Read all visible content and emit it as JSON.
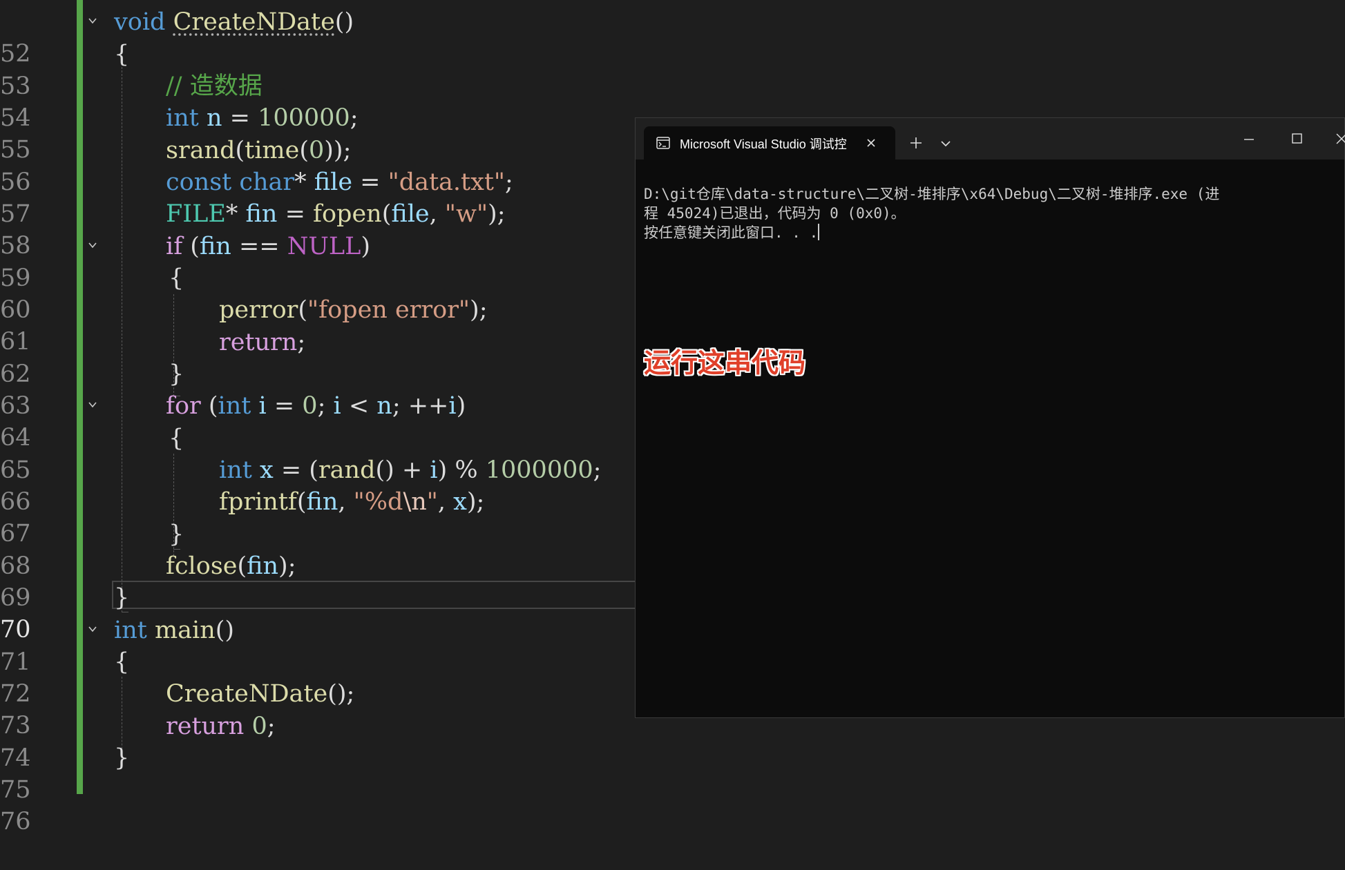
{
  "editor": {
    "lines": [
      {
        "n": "52"
      },
      {
        "n": "53"
      },
      {
        "n": "54"
      },
      {
        "n": "55"
      },
      {
        "n": "56"
      },
      {
        "n": "57"
      },
      {
        "n": "58"
      },
      {
        "n": "59"
      },
      {
        "n": "60"
      },
      {
        "n": "61"
      },
      {
        "n": "62"
      },
      {
        "n": "63"
      },
      {
        "n": "64"
      },
      {
        "n": "65"
      },
      {
        "n": "66"
      },
      {
        "n": "67"
      },
      {
        "n": "68"
      },
      {
        "n": "69"
      },
      {
        "n": "70"
      },
      {
        "n": "71"
      },
      {
        "n": "72"
      },
      {
        "n": "73"
      },
      {
        "n": "74"
      },
      {
        "n": "75"
      },
      {
        "n": "76"
      }
    ],
    "current_line": "70",
    "code": {
      "l52": {
        "kw": "void",
        "fn": "CreateNDate",
        "rest": "()"
      },
      "l53": "{",
      "l54": "// 造数据",
      "l55": {
        "kw": "int",
        "var": "n",
        "op": " = ",
        "num": "100000",
        "end": ";"
      },
      "l56": {
        "fn1": "srand",
        "p1": "(",
        "fn2": "time",
        "p2": "(",
        "num": "0",
        "end": "));"
      },
      "l57": {
        "kw1": "const",
        "kw2": "char",
        "star": "* ",
        "var": "file",
        "op": " = ",
        "str": "\"data.txt\"",
        "end": ";"
      },
      "l58": {
        "type": "FILE",
        "star": "* ",
        "var1": "fin",
        "op": " = ",
        "fn": "fopen",
        "p": "(",
        "var2": "file",
        "comma": ", ",
        "str": "\"w\"",
        "end": ");"
      },
      "l59": {
        "kw": "if",
        "p": " (",
        "var": "fin",
        "op": " == ",
        "mac": "NULL",
        "end": ")"
      },
      "l60": "{",
      "l61": {
        "fn": "perror",
        "p": "(",
        "str": "\"fopen error\"",
        "end": ");"
      },
      "l62": {
        "kw": "return",
        "end": ";"
      },
      "l63": "}",
      "l64": {
        "kw": "for",
        "p": " (",
        "kw2": "int",
        "var1": "i",
        "op1": " = ",
        "num": "0",
        "semi1": "; ",
        "var2": "i",
        "op2": " < ",
        "var3": "n",
        "semi2": "; ",
        "op3": "++",
        "var4": "i",
        "end": ")"
      },
      "l65": "{",
      "l66": {
        "kw": "int",
        "var1": "x",
        "op1": " = (",
        "fn": "rand",
        "p": "() + ",
        "var2": "i",
        "op2": ") % ",
        "num": "1000000",
        "end": ";"
      },
      "l67": {
        "fn": "fprintf",
        "p": "(",
        "var1": "fin",
        "comma": ", ",
        "str1": "\"%d",
        "esc": "\\n",
        "str2": "\"",
        "comma2": ", ",
        "var2": "x",
        "end": ");"
      },
      "l68": "}",
      "l69": {
        "fn": "fclose",
        "p": "(",
        "var": "fin",
        "end": ");"
      },
      "l70": "}",
      "l71": {
        "kw": "int",
        "fn": "main",
        "rest": "()"
      },
      "l72": "{",
      "l73": {
        "fn": "CreateNDate",
        "end": "();"
      },
      "l74": {
        "kw": "return",
        "num": "0",
        "end": ";"
      },
      "l75": "}"
    }
  },
  "terminal": {
    "tab_title": "Microsoft Visual Studio 调试控",
    "tab_icon": "terminal-icon",
    "output_line1": "D:\\git仓库\\data-structure\\二叉树-堆排序\\x64\\Debug\\二叉树-堆排序.exe (进",
    "output_line2": "程 45024)已退出，代码为 0 (0x0)。",
    "output_line3": "按任意键关闭此窗口. . .",
    "annotation": "运行这串代码"
  },
  "colors": {
    "editor_bg": "#1e1e1e",
    "change_bar": "#57a64a",
    "keyword": "#569cd6",
    "control": "#d8a0df",
    "function": "#dcdcaa",
    "string": "#d69d85",
    "number": "#b5cea8",
    "variable": "#9cdcfe",
    "comment": "#57a64a",
    "annotation_red": "#e0402a"
  }
}
